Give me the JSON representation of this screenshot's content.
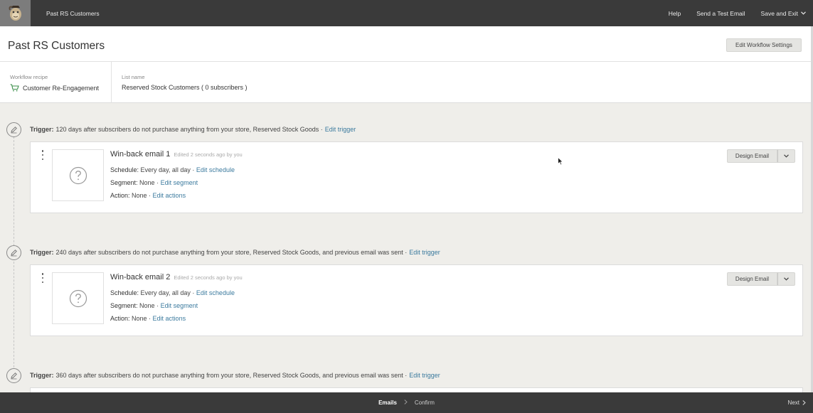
{
  "topbar": {
    "title": "Past RS Customers",
    "help": "Help",
    "send_test": "Send a Test Email",
    "save_exit": "Save and Exit"
  },
  "header": {
    "title": "Past RS Customers",
    "edit_settings": "Edit Workflow Settings"
  },
  "info": {
    "recipe_label": "Workflow recipe",
    "recipe_value": "Customer Re-Engagement",
    "list_label": "List name",
    "list_value": "Reserved Stock Customers ( 0 subscribers )"
  },
  "triggers": [
    {
      "label": "Trigger:",
      "text": "120 days after subscribers do not purchase anything from your store, Reserved Stock Goods · ",
      "edit": "Edit trigger"
    },
    {
      "label": "Trigger:",
      "text": "240 days after subscribers do not purchase anything from your store, Reserved Stock Goods, and previous email was sent · ",
      "edit": "Edit trigger"
    },
    {
      "label": "Trigger:",
      "text": "360 days after subscribers do not purchase anything from your store, Reserved Stock Goods, and previous email was sent · ",
      "edit": "Edit trigger"
    }
  ],
  "emails": [
    {
      "name": "Win-back email 1",
      "edited": "Edited 2 seconds ago by you",
      "schedule_label": "Schedule:",
      "schedule_value": "Every day, all day · ",
      "schedule_edit": "Edit schedule",
      "segment_label": "Segment:",
      "segment_value": "None · ",
      "segment_edit": "Edit segment",
      "action_label": "Action:",
      "action_value": "None · ",
      "action_edit": "Edit actions",
      "design": "Design Email"
    },
    {
      "name": "Win-back email 2",
      "edited": "Edited 2 seconds ago by you",
      "schedule_label": "Schedule:",
      "schedule_value": "Every day, all day · ",
      "schedule_edit": "Edit schedule",
      "segment_label": "Segment:",
      "segment_value": "None · ",
      "segment_edit": "Edit segment",
      "action_label": "Action:",
      "action_value": "None · ",
      "action_edit": "Edit actions",
      "design": "Design Email"
    }
  ],
  "footer": {
    "step_emails": "Emails",
    "step_confirm": "Confirm",
    "next": "Next"
  },
  "icons": {
    "logo": "mailchimp-logo-icon",
    "cart": "cart-icon",
    "trigger": "pencil-icon",
    "placeholder": "question-icon",
    "menu": "kebab-icon",
    "dropdown": "chevron-down-icon",
    "next": "chevron-right-icon"
  },
  "colors": {
    "topbar_bg": "#3a3a3a",
    "link": "#3b7a9e",
    "cart_green": "#3b8f4a"
  }
}
